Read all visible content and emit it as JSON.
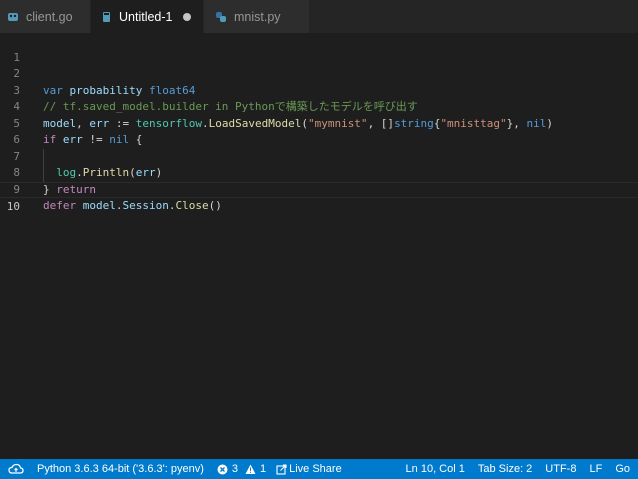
{
  "tabs": [
    {
      "label": "client.go",
      "icon": "go-file-icon",
      "active": false
    },
    {
      "label": "Untitled-1",
      "icon": "file-icon",
      "active": true,
      "dirty": true
    },
    {
      "label": "mnist.py",
      "icon": "python-icon",
      "active": false
    }
  ],
  "editor": {
    "line_numbers": [
      "1",
      "2",
      "3",
      "4",
      "5",
      "6",
      "7",
      "8",
      "9",
      "10"
    ],
    "current_line": "10",
    "code_lines": [
      "",
      "var probability float64",
      "// tf.saved_model.builder in Pythonで構築したモデルを呼び出す",
      "model, err := tensorflow.LoadSavedModel(\"mymnist\", []string{\"mnisttag\"}, nil)",
      "if err != nil {",
      "  log.Println(err)",
      "  return",
      "}",
      "defer model.Session.Close()",
      ""
    ]
  },
  "status_bar": {
    "interpreter": "Python 3.6.3 64-bit ('3.6.3': pyenv)",
    "errors": "3",
    "warnings": "1",
    "live_share": "Live Share",
    "cursor_position": "Ln 10, Col 1",
    "tab_size": "Tab Size: 2",
    "encoding": "UTF-8",
    "line_ending": "LF",
    "language": "Go"
  },
  "colors": {
    "accent": "#007acc",
    "editor_bg": "#1e1e1e",
    "tabbar_bg": "#252526"
  }
}
